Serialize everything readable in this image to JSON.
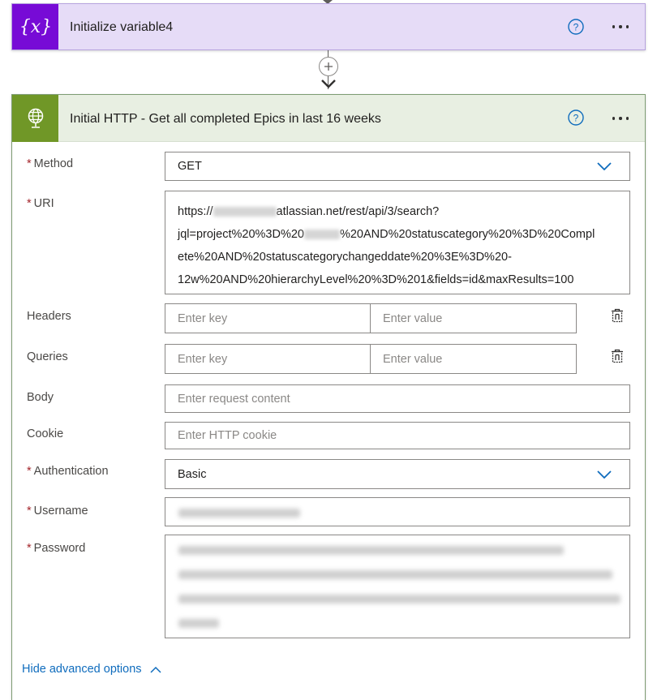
{
  "card_variable": {
    "title": "Initialize variable4",
    "icon": "variable-icon",
    "color": "#770bd6"
  },
  "card_http": {
    "title": "Initial HTTP - Get all completed Epics in last 16 weeks",
    "icon": "globe-icon",
    "color": "#709727"
  },
  "fields": {
    "method": {
      "label": "Method",
      "required": "*",
      "value": "GET"
    },
    "uri": {
      "label": "URI",
      "required": "*",
      "line1_prefix": "https://",
      "line1_suffix": "atlassian.net/rest/api/3/search?",
      "line2_prefix": "jql=project%20%3D%20",
      "line2_suffix": "%20AND%20statuscategory%20%3D%20Compl",
      "line3": "ete%20AND%20statuscategorychangeddate%20%3E%3D%20-",
      "line4": "12w%20AND%20hierarchyLevel%20%3D%201&fields=id&maxResults=100"
    },
    "headers": {
      "label": "Headers",
      "key_placeholder": "Enter key",
      "value_placeholder": "Enter value"
    },
    "queries": {
      "label": "Queries",
      "key_placeholder": "Enter key",
      "value_placeholder": "Enter value"
    },
    "body": {
      "label": "Body",
      "placeholder": "Enter request content"
    },
    "cookie": {
      "label": "Cookie",
      "placeholder": "Enter HTTP cookie"
    },
    "authentication": {
      "label": "Authentication",
      "required": "*",
      "value": "Basic"
    },
    "username": {
      "label": "Username",
      "required": "*"
    },
    "password": {
      "label": "Password",
      "required": "*"
    }
  },
  "advanced": {
    "label": "Hide advanced options"
  },
  "colors": {
    "link": "#0f6cbd",
    "required": "#a4262c",
    "border": "#8a8886"
  }
}
